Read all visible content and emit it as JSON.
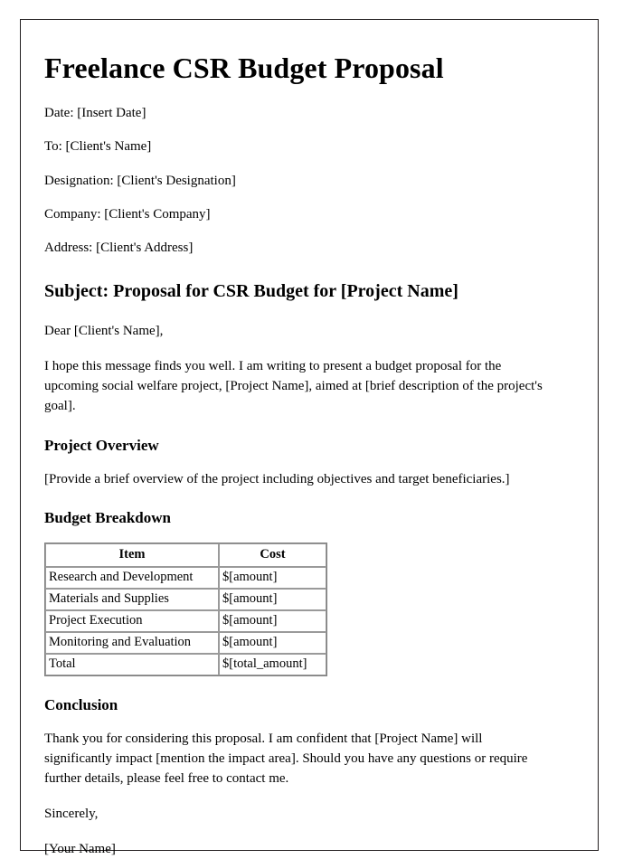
{
  "document": {
    "title": "Freelance CSR Budget Proposal",
    "meta_fields": [
      "Date: [Insert Date]",
      "To: [Client's Name]",
      "Designation: [Client's Designation]",
      "Company: [Client's Company]",
      "Address: [Client's Address]"
    ],
    "subject_heading": "Subject: Proposal for CSR Budget for [Project Name]",
    "salutation": "Dear [Client's Name],",
    "intro_paragraph": "I hope this message finds you well. I am writing to present a budget proposal for the upcoming social welfare project, [Project Name], aimed at [brief description of the project's goal].",
    "project_overview": {
      "heading": "Project Overview",
      "text": "[Provide a brief overview of the project including objectives and target beneficiaries.]"
    },
    "budget_breakdown": {
      "heading": "Budget Breakdown",
      "table": {
        "columns": [
          "Item",
          "Cost"
        ],
        "rows": [
          {
            "item": "Research and Development",
            "cost": "$[amount]"
          },
          {
            "item": "Materials and Supplies",
            "cost": "$[amount]"
          },
          {
            "item": "Project Execution",
            "cost": "$[amount]"
          },
          {
            "item": "Monitoring and Evaluation",
            "cost": "$[amount]"
          },
          {
            "item": "Total",
            "cost": "$[total_amount]"
          }
        ]
      }
    },
    "conclusion": {
      "heading": "Conclusion",
      "text": "Thank you for considering this proposal. I am confident that [Project Name] will significantly impact [mention the impact area]. Should you have any questions or require further details, please feel free to contact me."
    },
    "closing": "Sincerely,",
    "signer": "[Your Name]"
  }
}
